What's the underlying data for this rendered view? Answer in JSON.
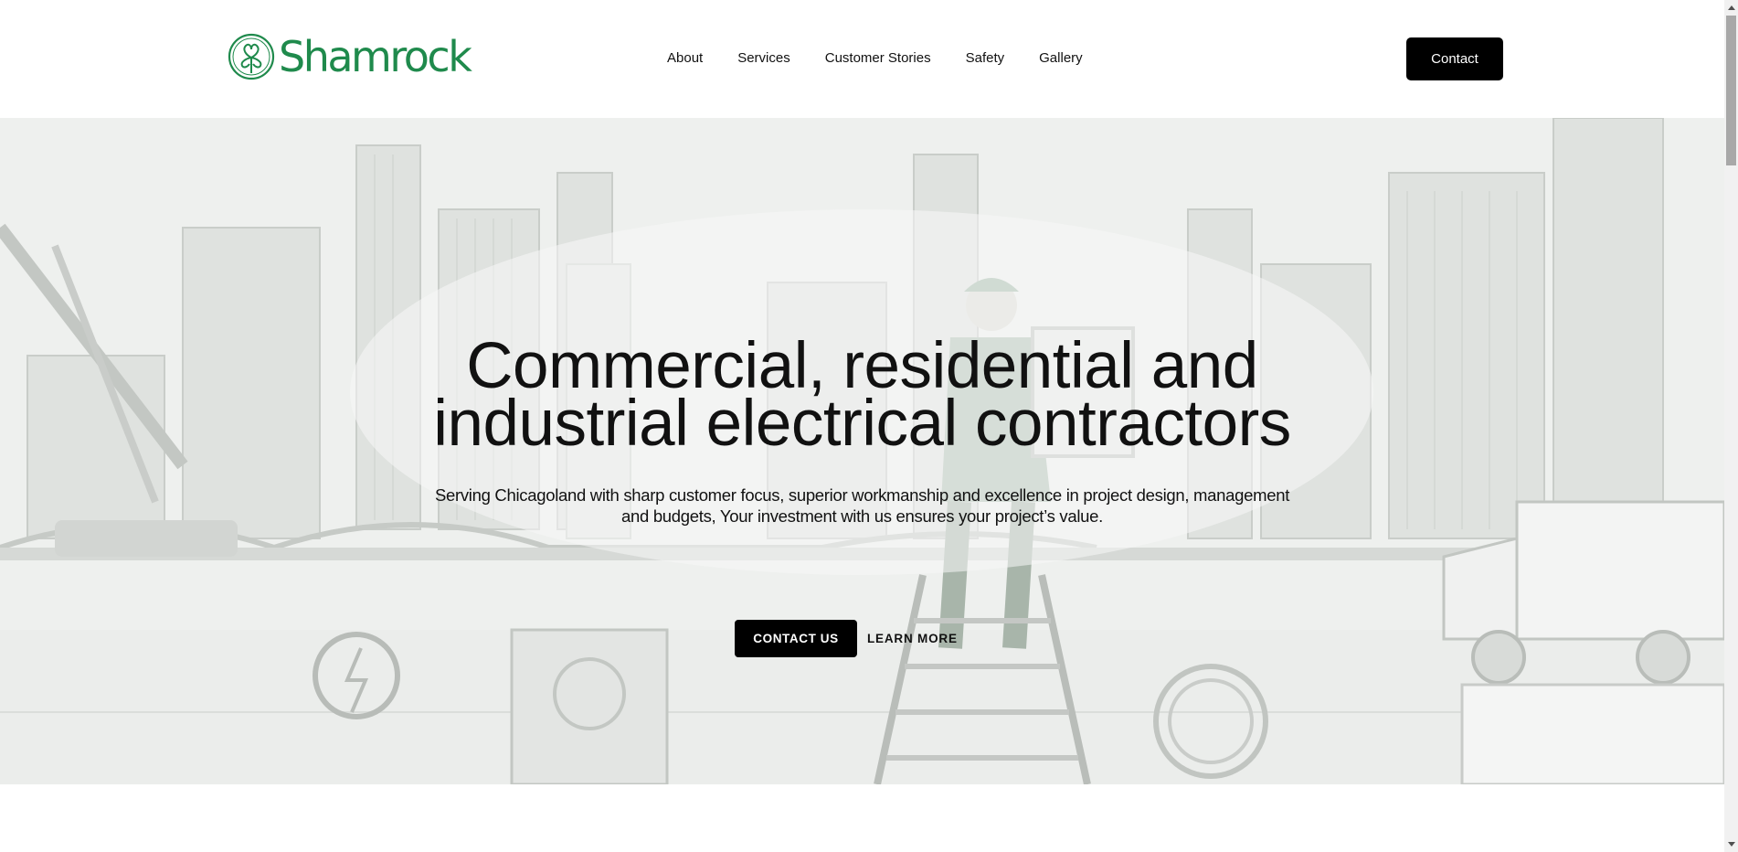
{
  "brand": {
    "name": "Shamrock",
    "logo_icon": "shamrock-icon",
    "color": "#1f8a4c"
  },
  "nav": {
    "items": [
      {
        "label": "About"
      },
      {
        "label": "Services"
      },
      {
        "label": "Customer Stories"
      },
      {
        "label": "Safety"
      },
      {
        "label": "Gallery"
      }
    ],
    "contact_label": "Contact"
  },
  "hero": {
    "title_line1": "Commercial, residential and",
    "title_line2": "industrial electrical contractors",
    "subtitle": "Serving Chicagoland with sharp customer focus, superior workmanship and excellence in project design, management and budgets, Your investment with us ensures your project’s value.",
    "primary_button": "CONTACT US",
    "secondary_button": "LEARN MORE",
    "background": "faded-illustration-electrician-city-skyline"
  },
  "colors": {
    "accent": "#000000",
    "brand_green": "#1f8a4c",
    "hero_bg": "#f2f3f2"
  }
}
